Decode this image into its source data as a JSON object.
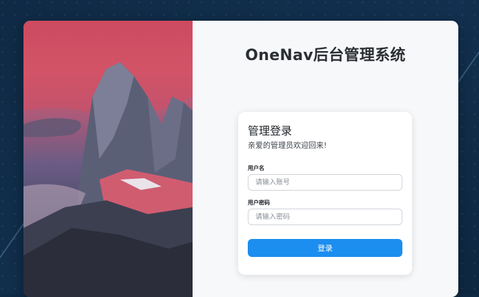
{
  "app": {
    "title": "OneNav后台管理系统"
  },
  "login": {
    "title": "管理登录",
    "subtitle": "亲爱的管理员欢迎回来!",
    "username": {
      "label": "用户名",
      "placeholder": "请输入账号",
      "value": ""
    },
    "password": {
      "label": "用户密码",
      "placeholder": "请输入密码",
      "value": ""
    },
    "submit_label": "登录"
  },
  "colors": {
    "page_background": "#0f2a45",
    "card_background": "#f7f8fa",
    "accent": "#1b8ef0"
  }
}
